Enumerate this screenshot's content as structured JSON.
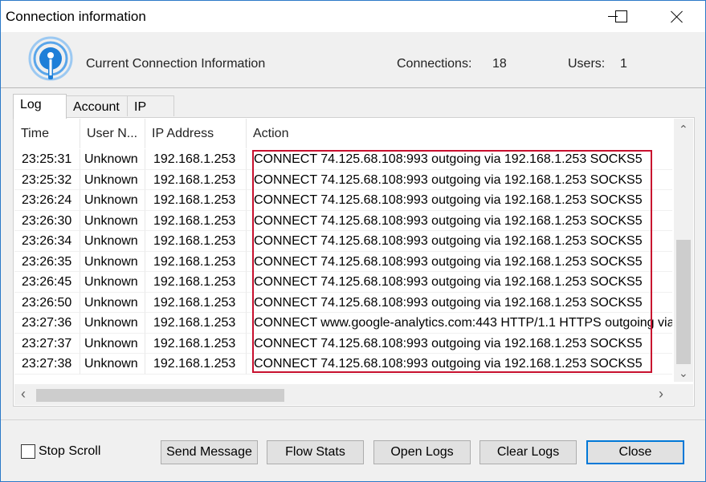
{
  "window": {
    "title": "Connection information"
  },
  "header": {
    "subtitle": "Current Connection Information",
    "connections_label": "Connections:",
    "connections_value": "18",
    "users_label": "Users:",
    "users_value": "1"
  },
  "tabs": [
    {
      "label": "Log",
      "active": true
    },
    {
      "label": "Account",
      "active": false
    },
    {
      "label": "IP",
      "active": false
    }
  ],
  "table": {
    "columns": [
      "Time",
      "User N...",
      "IP Address",
      "Action"
    ],
    "rows": [
      {
        "time": "23:25:31",
        "user": "Unknown",
        "ip": "192.168.1.253",
        "action": "CONNECT 74.125.68.108:993 outgoing via 192.168.1.253 SOCKS5"
      },
      {
        "time": "23:25:32",
        "user": "Unknown",
        "ip": "192.168.1.253",
        "action": "CONNECT 74.125.68.108:993 outgoing via 192.168.1.253 SOCKS5"
      },
      {
        "time": "23:26:24",
        "user": "Unknown",
        "ip": "192.168.1.253",
        "action": "CONNECT 74.125.68.108:993 outgoing via 192.168.1.253 SOCKS5"
      },
      {
        "time": "23:26:30",
        "user": "Unknown",
        "ip": "192.168.1.253",
        "action": "CONNECT 74.125.68.108:993 outgoing via 192.168.1.253 SOCKS5"
      },
      {
        "time": "23:26:34",
        "user": "Unknown",
        "ip": "192.168.1.253",
        "action": "CONNECT 74.125.68.108:993 outgoing via 192.168.1.253 SOCKS5"
      },
      {
        "time": "23:26:35",
        "user": "Unknown",
        "ip": "192.168.1.253",
        "action": "CONNECT 74.125.68.108:993 outgoing via 192.168.1.253 SOCKS5"
      },
      {
        "time": "23:26:45",
        "user": "Unknown",
        "ip": "192.168.1.253",
        "action": "CONNECT 74.125.68.108:993 outgoing via 192.168.1.253 SOCKS5"
      },
      {
        "time": "23:26:50",
        "user": "Unknown",
        "ip": "192.168.1.253",
        "action": "CONNECT 74.125.68.108:993 outgoing via 192.168.1.253 SOCKS5"
      },
      {
        "time": "23:27:36",
        "user": "Unknown",
        "ip": "192.168.1.253",
        "action": "CONNECT www.google-analytics.com:443 HTTP/1.1 HTTPS outgoing via"
      },
      {
        "time": "23:27:37",
        "user": "Unknown",
        "ip": "192.168.1.253",
        "action": "CONNECT 74.125.68.108:993 outgoing via 192.168.1.253 SOCKS5"
      },
      {
        "time": "23:27:38",
        "user": "Unknown",
        "ip": "192.168.1.253",
        "action": "CONNECT 74.125.68.108:993 outgoing via 192.168.1.253 SOCKS5"
      }
    ]
  },
  "footer": {
    "stop_scroll_label": "Stop Scroll",
    "stop_scroll_checked": false,
    "buttons": {
      "send_message": "Send Message",
      "flow_stats": "Flow Stats",
      "open_logs": "Open Logs",
      "clear_logs": "Clear Logs",
      "close": "Close"
    }
  },
  "icons": {
    "logo": "wireless-broadcast-icon",
    "scroll_up": "chevron-up-icon",
    "scroll_down": "chevron-down-icon",
    "scroll_left": "chevron-left-icon",
    "scroll_right": "chevron-right-icon"
  },
  "colors": {
    "highlight_border": "#c8102e",
    "default_button_border": "#0078d7",
    "logo_blue": "#1e7fd8"
  }
}
